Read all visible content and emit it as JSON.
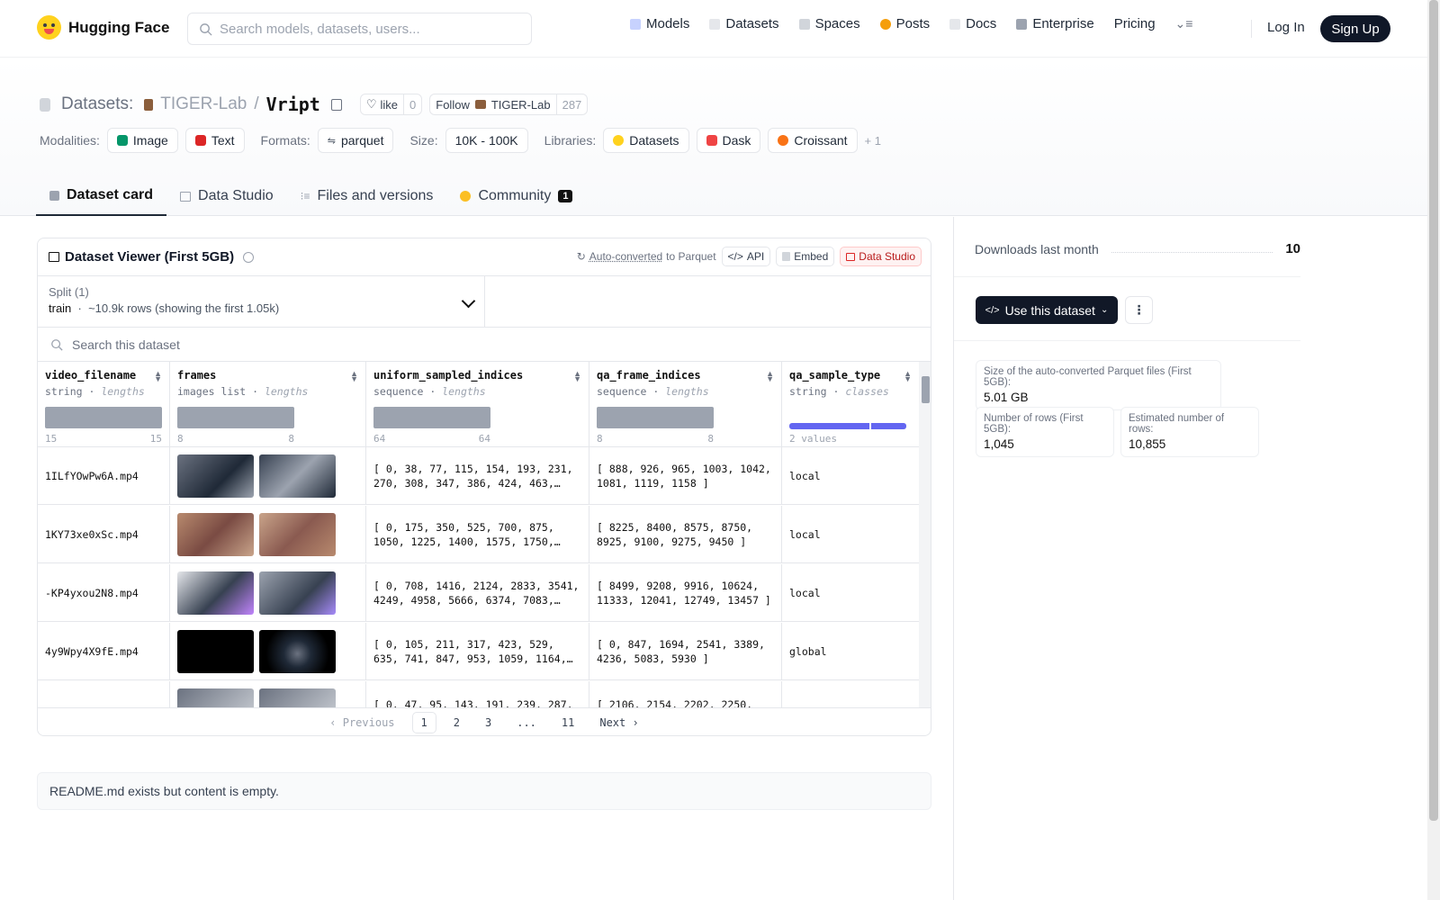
{
  "header": {
    "brand": "Hugging Face",
    "search_placeholder": "Search models, datasets, users...",
    "nav": [
      {
        "label": "Models",
        "icon": "models-icon",
        "color": "#a5b4fc"
      },
      {
        "label": "Datasets",
        "icon": "datasets-icon",
        "color": "#e5e7eb"
      },
      {
        "label": "Spaces",
        "icon": "spaces-icon",
        "color": "#c7d2fe"
      },
      {
        "label": "Posts",
        "icon": "posts-icon",
        "color": "#f59e0b"
      },
      {
        "label": "Docs",
        "icon": "docs-icon",
        "color": "#e5e7eb"
      },
      {
        "label": "Enterprise",
        "icon": "enterprise-icon",
        "color": "#6b7280"
      },
      {
        "label": "Pricing",
        "icon": "",
        "color": ""
      }
    ],
    "login": "Log In",
    "signup": "Sign Up"
  },
  "repo": {
    "type_label": "Datasets:",
    "owner": "TIGER-Lab",
    "separator": "/",
    "name": "Vript",
    "like_label": "like",
    "like_count": "0",
    "follow_label": "Follow",
    "follow_owner": "TIGER-Lab",
    "follow_count": "287"
  },
  "meta": {
    "modalities_label": "Modalities:",
    "modalities": [
      "Image",
      "Text"
    ],
    "formats_label": "Formats:",
    "format": "parquet",
    "size_label": "Size:",
    "size": "10K - 100K",
    "libraries_label": "Libraries:",
    "libraries": [
      "Datasets",
      "Dask",
      "Croissant"
    ],
    "more_libraries": "+ 1"
  },
  "tabs": [
    {
      "label": "Dataset card",
      "active": true
    },
    {
      "label": "Data Studio",
      "active": false
    },
    {
      "label": "Files and versions",
      "active": false
    },
    {
      "label": "Community",
      "active": false,
      "badge": "1"
    }
  ],
  "viewer": {
    "title": "Dataset Viewer (First 5GB)",
    "auto_converted": "Auto-converted",
    "to_parquet": "to Parquet",
    "api": "API",
    "embed": "Embed",
    "data_studio": "Data Studio",
    "split_label": "Split (1)",
    "split_name": "train",
    "split_info": "~10.9k rows (showing the first 1.05k)",
    "search_placeholder": "Search this dataset",
    "columns": [
      {
        "name": "video_filename",
        "type": "string",
        "kind": "lengths",
        "min": "15",
        "max": "15"
      },
      {
        "name": "frames",
        "type": "images list",
        "kind": "lengths",
        "min": "8",
        "max": "8"
      },
      {
        "name": "uniform_sampled_indices",
        "type": "sequence",
        "kind": "lengths",
        "min": "64",
        "max": "64"
      },
      {
        "name": "qa_frame_indices",
        "type": "sequence",
        "kind": "lengths",
        "min": "8",
        "max": "8"
      },
      {
        "name": "qa_sample_type",
        "type": "string",
        "kind": "classes",
        "min": "2 values",
        "max": ""
      }
    ],
    "class_colors": [
      "#6366f1",
      "#818cf8"
    ],
    "rows": [
      {
        "video_filename": "1ILfYOwPw6A.mp4",
        "uniform": "[ 0, 38, 77, 115, 154, 193, 231, 270, 308, 347, 386, 424, 463,…",
        "qa": "[ 888, 926, 965, 1003, 1042, 1081, 1119, 1158 ]",
        "type": "local",
        "thumbs": [
          "#4b5563",
          "#374151"
        ]
      },
      {
        "video_filename": "1KY73xe0xSc.mp4",
        "uniform": "[ 0, 175, 350, 525, 700, 875, 1050, 1225, 1400, 1575, 1750,…",
        "qa": "[ 8225, 8400, 8575, 8750, 8925, 9100, 9275, 9450 ]",
        "type": "local",
        "thumbs": [
          "#a36a5a",
          "#9a6156"
        ]
      },
      {
        "video_filename": "-KP4yxou2N8.mp4",
        "uniform": "[ 0, 708, 1416, 2124, 2833, 3541, 4249, 4958, 5666, 6374, 7083,…",
        "qa": "[ 8499, 9208, 9916, 10624, 11333, 12041, 12749, 13457 ]",
        "type": "local",
        "thumbs": [
          "#c7ccd6",
          "#6b7280"
        ]
      },
      {
        "video_filename": "4y9Wpy4X9fE.mp4",
        "uniform": "[ 0, 105, 211, 317, 423, 529, 635, 741, 847, 953, 1059, 1164,…",
        "qa": "[ 0, 847, 1694, 2541, 3389, 4236, 5083, 5930 ]",
        "type": "global",
        "thumbs": [
          "#000000",
          "#1f2937"
        ]
      },
      {
        "video_filename": "",
        "uniform": "[ 0, 47, 95, 143, 191, 239, 287,",
        "qa": "[ 2106, 2154, 2202, 2250,",
        "type": "",
        "thumbs": [
          "#6b7280",
          "#6b7280"
        ]
      }
    ],
    "pager": {
      "prev": "Previous",
      "pages": [
        "1",
        "2",
        "3",
        "...",
        "11"
      ],
      "next": "Next"
    }
  },
  "readme": "README.md exists but content is empty.",
  "sidebar": {
    "downloads_label": "Downloads last month",
    "downloads_value": "10",
    "use_button": "Use this dataset",
    "stats": [
      {
        "label": "Size of the auto-converted Parquet files (First 5GB):",
        "value": "5.01 GB"
      },
      {
        "label": "Number of rows (First 5GB):",
        "value": "1,045"
      },
      {
        "label": "Estimated number of rows:",
        "value": "10,855"
      }
    ]
  }
}
